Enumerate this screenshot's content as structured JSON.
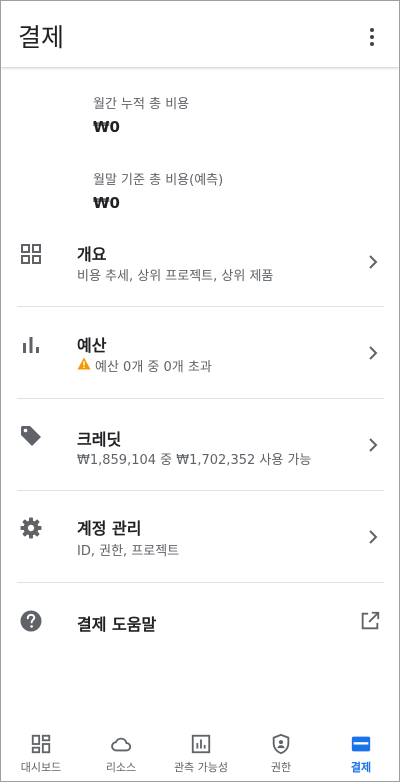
{
  "header": {
    "title": "결제"
  },
  "summary": {
    "monthly_label": "월간 누적 총 비용",
    "monthly_value": "₩0",
    "forecast_label": "월말 기준 총 비용(예측)",
    "forecast_value": "₩0"
  },
  "rows": [
    {
      "label": "개요",
      "sub": "비용 추세, 상위 프로젝트, 상위 제품",
      "icon": "grid-icon"
    },
    {
      "label": "예산",
      "sub": "예산 0개 중 0개 초과",
      "icon": "bar-chart-icon",
      "sub_icon": "warning-icon"
    },
    {
      "label": "크레딧",
      "sub": "₩1,859,104 중 ₩1,702,352 사용 가능",
      "icon": "tag-icon"
    },
    {
      "label": "계정 관리",
      "sub": "ID, 권한, 프로젝트",
      "icon": "gear-icon"
    },
    {
      "label": "결제 도움말",
      "icon": "help-icon",
      "trailing_icon": "open-in-new-icon"
    }
  ],
  "bottom_nav": [
    {
      "label": "대시보드",
      "icon": "dashboard-icon"
    },
    {
      "label": "리소스",
      "icon": "cloud-icon"
    },
    {
      "label": "관측 가능성",
      "icon": "monitoring-icon"
    },
    {
      "label": "권한",
      "icon": "shield-icon"
    },
    {
      "label": "결제",
      "icon": "billing-card-icon",
      "active": true
    }
  ],
  "colors": {
    "accent": "#1a73e8",
    "warning": "#f29900",
    "icon_gray": "#5f6368",
    "divider": "#e0e0e0"
  }
}
